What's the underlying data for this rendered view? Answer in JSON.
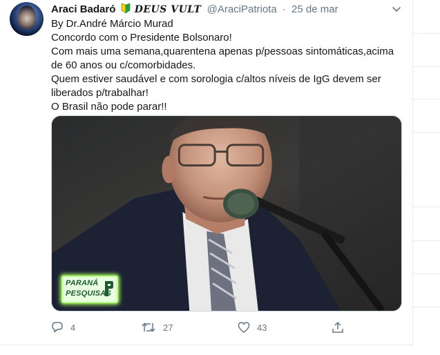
{
  "tweet": {
    "name": "Araci Badaró",
    "tag": "DEUS VULT",
    "handle": "@AraciPatriota",
    "separator": "·",
    "time": "25 de mar",
    "lines": [
      "By Dr.André Márcio Murad",
      "Concordo com o Presidente Bolsonaro!",
      "Com mais uma semana,quarentena apenas p/pessoas sintomáticas,acima de 60 anos ou c/comorbidades.",
      "Quem estiver saudável e com sorologia c/altos níveis de IgG devem ser liberados p/trabalhar!",
      "O Brasil não pode parar!!"
    ],
    "media": {
      "logo_line1": "PARANÁ",
      "logo_line2": "PESQUISAS"
    },
    "actions": {
      "replies": "4",
      "retweets": "27",
      "likes": "43"
    }
  },
  "icons": {
    "badge": "beginner-badge-icon",
    "more": "chevron-down-icon",
    "reply": "reply-icon",
    "retweet": "retweet-icon",
    "like": "heart-icon",
    "share": "share-icon"
  },
  "colors": {
    "text": "#14171a",
    "muted": "#657786",
    "border": "#e6ecf0",
    "logo_green": "#1f5b32",
    "logo_glow": "#a7ff5a"
  }
}
